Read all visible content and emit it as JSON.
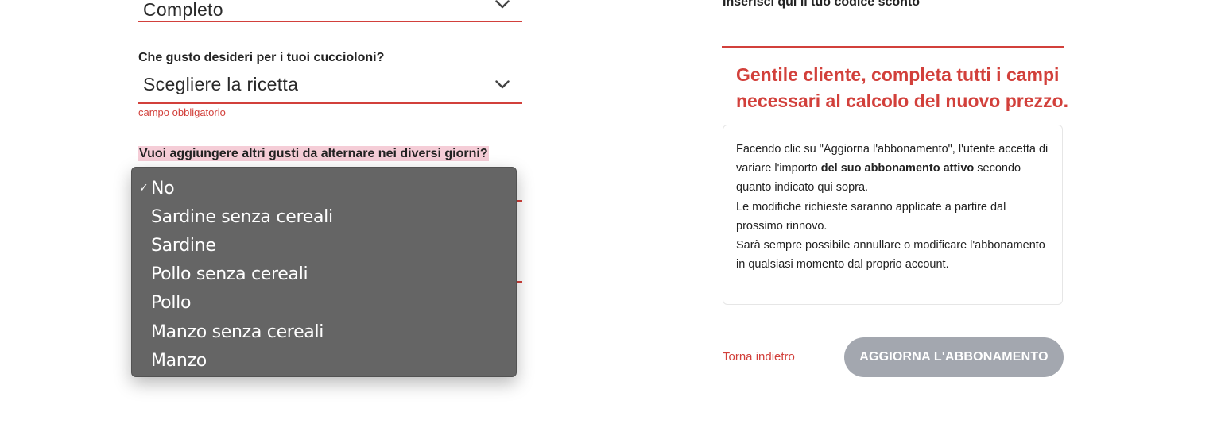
{
  "form": {
    "size_select": {
      "value": "Completo"
    },
    "recipe_select": {
      "label": "Che gusto desideri per i tuoi cuccioloni?",
      "value": "Scegliere la ricetta",
      "error": "campo obbligatorio"
    },
    "alternate_flavors": {
      "label": "Vuoi aggiungere altri gusti da alternare nei diversi giorni?",
      "options": [
        {
          "label": "No",
          "selected": true
        },
        {
          "label": "Sardine senza cereali",
          "selected": false
        },
        {
          "label": "Sardine",
          "selected": false
        },
        {
          "label": "Pollo senza cereali",
          "selected": false
        },
        {
          "label": "Pollo",
          "selected": false
        },
        {
          "label": "Manzo senza cereali",
          "selected": false
        },
        {
          "label": "Manzo",
          "selected": false
        }
      ],
      "check_glyph": "✓"
    }
  },
  "coupon": {
    "label": "Inserisci qui il tuo codice sconto",
    "value": ""
  },
  "warning": "Gentile cliente, completa tutti i campi necessari al calcolo del nuovo prezzo.",
  "notice": {
    "line1_prefix": "Facendo clic su \"Aggiorna l'abbonamento\", l'utente accetta di variare l'importo ",
    "line1_bold": "del suo abbonamento attivo",
    "line1_suffix": " secondo quanto indicato qui sopra.",
    "line2": "Le modifiche richieste saranno applicate a partire dal prossimo rinnovo.",
    "line3": "Sarà sempre possibile annullare o modificare l'abbonamento in qualsiasi momento dal proprio account."
  },
  "actions": {
    "back_label": "Torna indietro",
    "update_label": "AGGIORNA L'ABBONAMENTO"
  },
  "colors": {
    "accent": "#d2403b",
    "button_disabled": "#a3a7af",
    "dropdown_bg": "#656565",
    "label_highlight": "#f5cdd7"
  },
  "icons": {
    "select_chevron": "chevron-down-icon",
    "selected_option": "check-icon"
  }
}
